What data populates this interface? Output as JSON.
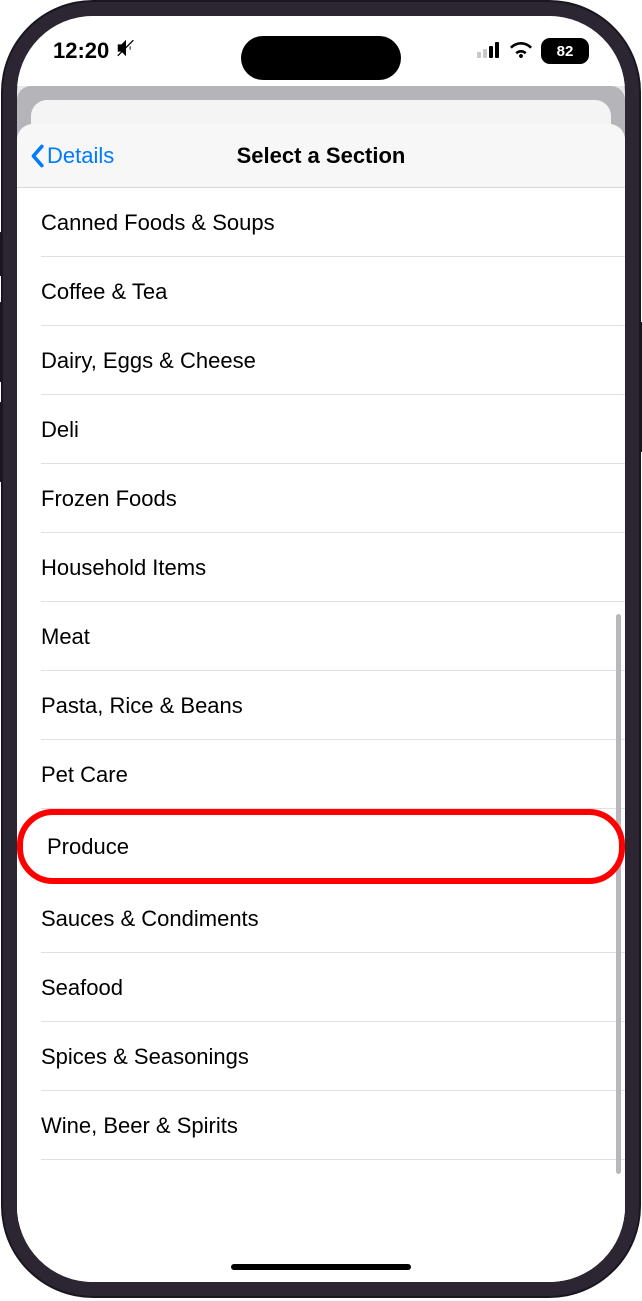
{
  "status": {
    "time": "12:20",
    "battery": "82"
  },
  "nav": {
    "back_label": "Details",
    "title": "Select a Section"
  },
  "sections": {
    "items": [
      {
        "label": "Canned Foods & Soups",
        "highlighted": false
      },
      {
        "label": "Coffee & Tea",
        "highlighted": false
      },
      {
        "label": "Dairy, Eggs & Cheese",
        "highlighted": false
      },
      {
        "label": "Deli",
        "highlighted": false
      },
      {
        "label": "Frozen Foods",
        "highlighted": false
      },
      {
        "label": "Household Items",
        "highlighted": false
      },
      {
        "label": "Meat",
        "highlighted": false
      },
      {
        "label": "Pasta, Rice & Beans",
        "highlighted": false
      },
      {
        "label": "Pet Care",
        "highlighted": false
      },
      {
        "label": "Produce",
        "highlighted": true
      },
      {
        "label": "Sauces & Condiments",
        "highlighted": false
      },
      {
        "label": "Seafood",
        "highlighted": false
      },
      {
        "label": "Spices & Seasonings",
        "highlighted": false
      },
      {
        "label": "Wine, Beer & Spirits",
        "highlighted": false
      }
    ]
  }
}
